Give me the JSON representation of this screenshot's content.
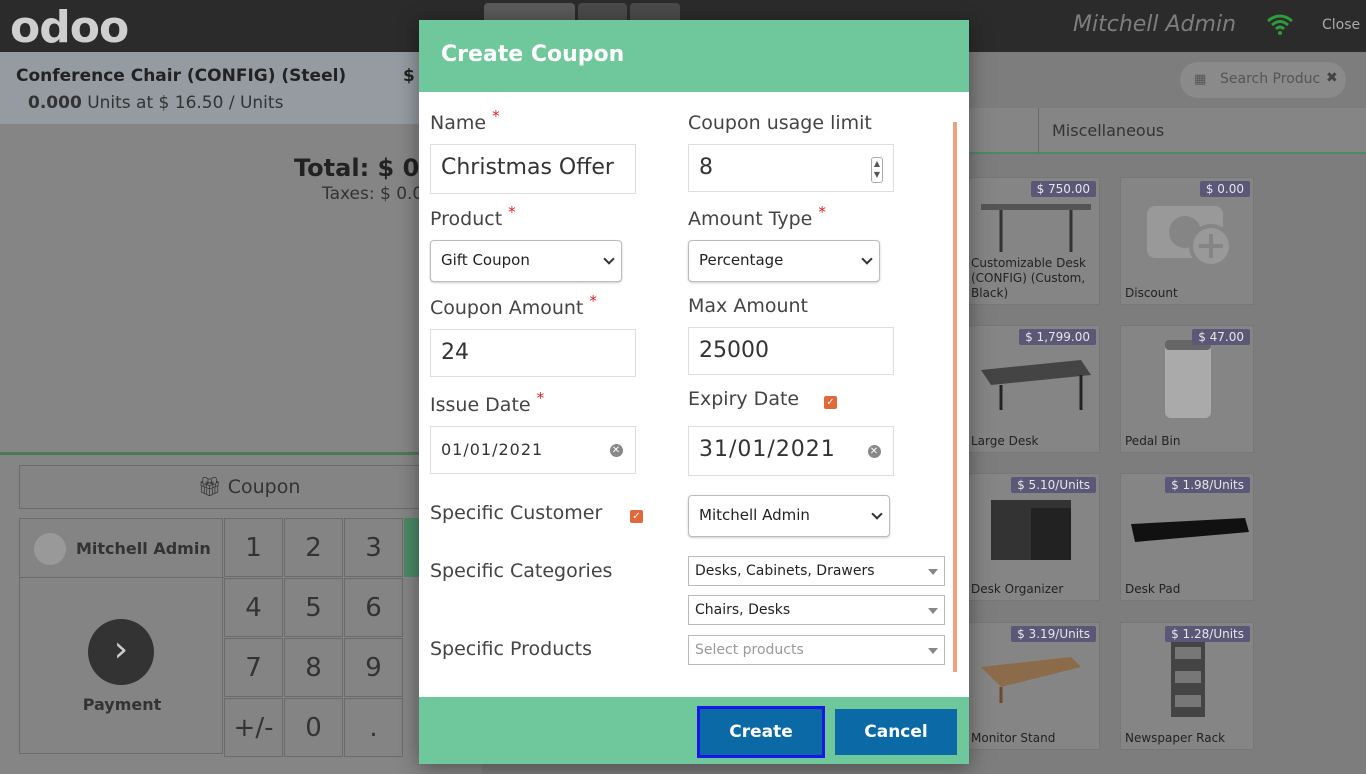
{
  "app": {
    "logo": "odoo",
    "user": "Mitchell Admin",
    "close": "Close"
  },
  "order": {
    "line_name": "Conference Chair (CONFIG) (Steel)",
    "line_price": "$",
    "line_qty": "0.000",
    "line_qty_rest": "Units at $ 16.50 / Units",
    "total": "Total: $ 0",
    "taxes": "Taxes: $ 0.0"
  },
  "actions": {
    "coupon": "Coupon",
    "customer": "Mitchell Admin",
    "payment": "Payment"
  },
  "numpad": [
    "1",
    "2",
    "3",
    "4",
    "5",
    "6",
    "7",
    "8",
    "9",
    "+/-",
    "0",
    "."
  ],
  "products_panel": {
    "search_placeholder": "Search Products",
    "category": "Miscellaneous",
    "products": [
      {
        "name": "Customizable Desk (CONFIG) (Custom, Black)",
        "price": "$ 750.00"
      },
      {
        "name": "Discount",
        "price": "$ 0.00"
      },
      {
        "name": "Large Desk",
        "price": "$ 1,799.00"
      },
      {
        "name": "Pedal Bin",
        "price": "$ 47.00"
      },
      {
        "name": "Desk Organizer",
        "price": "$ 5.10/Units"
      },
      {
        "name": "Desk Pad",
        "price": "$ 1.98/Units"
      },
      {
        "name": "Monitor Stand",
        "price": "$ 3.19/Units"
      },
      {
        "name": "Newspaper Rack",
        "price": "$ 1.28/Units"
      }
    ]
  },
  "modal": {
    "title": "Create Coupon",
    "name_label": "Name",
    "name_value": "Christmas Offer",
    "usage_label": "Coupon usage limit",
    "usage_value": "8",
    "product_label": "Product",
    "product_value": "Gift Coupon",
    "amount_type_label": "Amount Type",
    "amount_type_value": "Percentage",
    "coupon_amount_label": "Coupon Amount",
    "coupon_amount_value": "24",
    "max_amount_label": "Max Amount",
    "max_amount_value": "25000",
    "issue_date_label": "Issue Date",
    "issue_date_value": "01/01/2021",
    "expiry_date_label": "Expiry Date",
    "expiry_date_value": "31/01/2021",
    "specific_customer_label": "Specific Customer",
    "specific_customer_value": "Mitchell Admin",
    "specific_categories_label": "Specific Categories",
    "category_1": "Desks, Cabinets, Drawers",
    "category_2": "Chairs, Desks",
    "specific_products_label": "Specific Products",
    "products_placeholder": "Select products",
    "required_mark": "*",
    "create": "Create",
    "cancel": "Cancel"
  },
  "colors": {
    "header": "#6ec89b",
    "primary_button": "#0b6aa6",
    "checkbox": "#e0683a"
  }
}
